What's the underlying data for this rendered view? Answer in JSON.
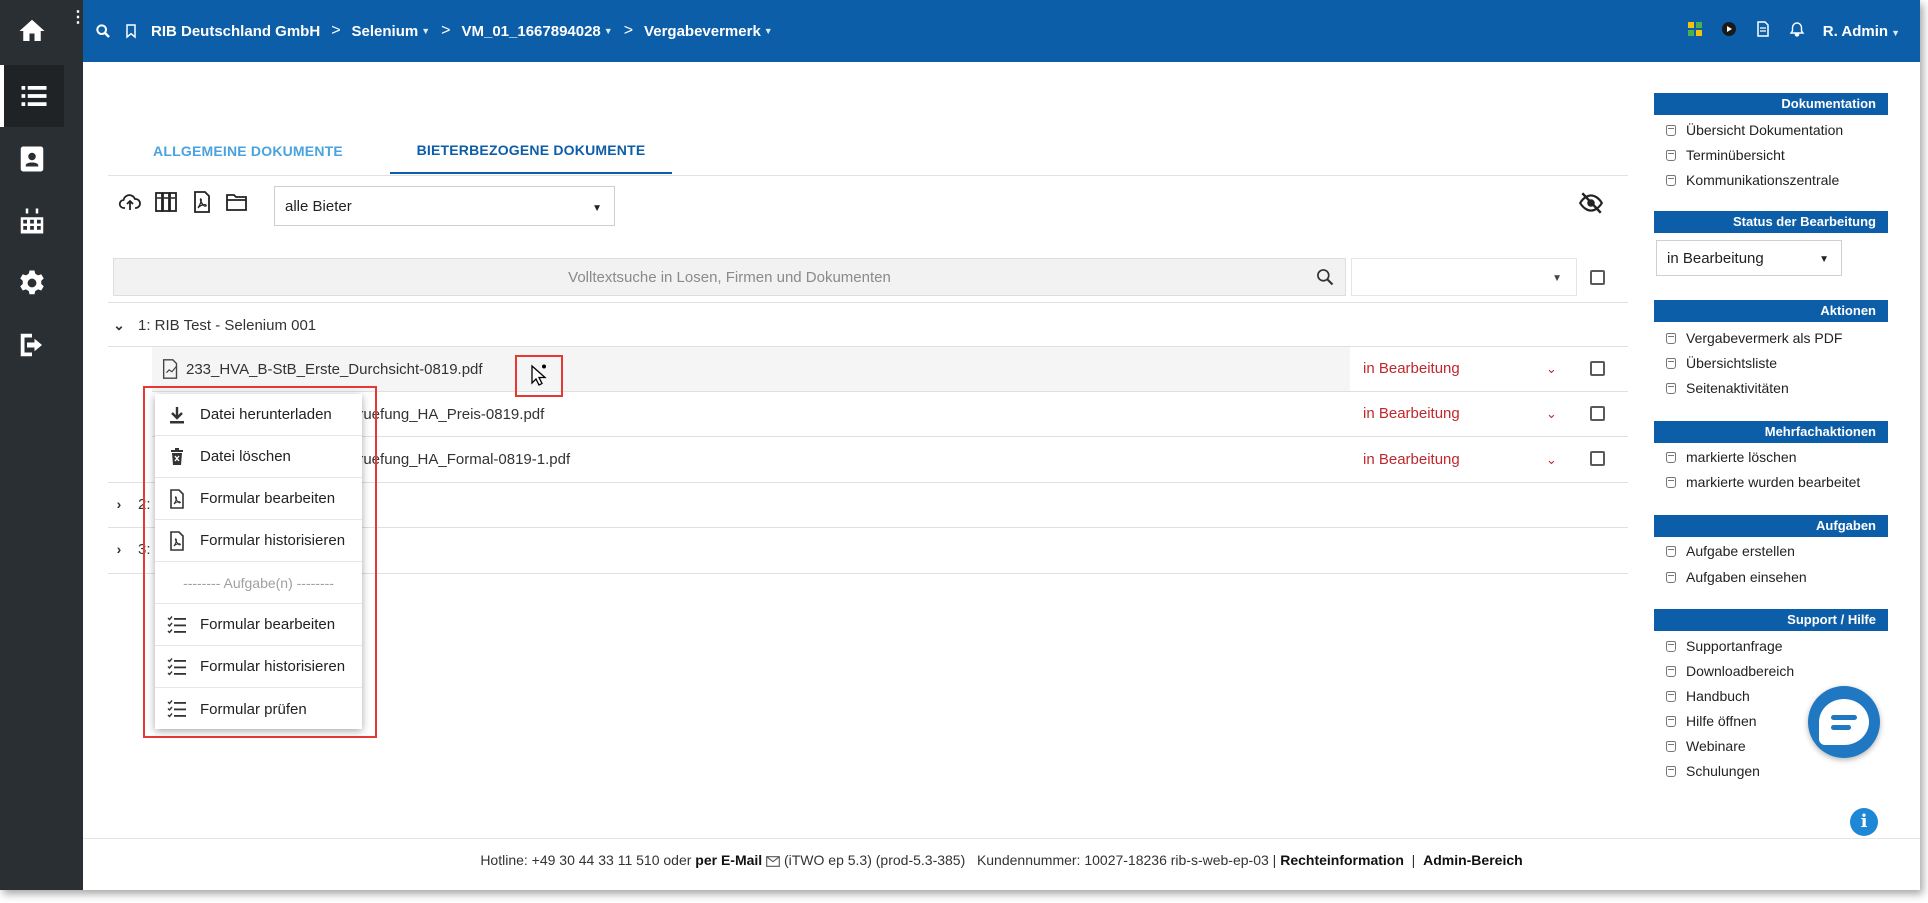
{
  "topbar": {
    "breadcrumb": [
      "RIB Deutschland GmbH",
      "Selenium",
      "VM_01_1667894028",
      "Vergabevermerk"
    ],
    "user": "R. Admin"
  },
  "tabs": {
    "allgemeine": "ALLGEMEINE DOKUMENTE",
    "bieter": "BIETERBEZOGENE DOKUMENTE"
  },
  "toolbar": {
    "bidder_filter": "alle Bieter"
  },
  "search": {
    "placeholder": "Volltextsuche in Losen, Firmen und Dokumenten"
  },
  "groups": [
    {
      "label": "1: RIB Test - Selenium 001"
    },
    {
      "label": "2: "
    },
    {
      "label": "3: "
    }
  ],
  "documents": [
    {
      "name": "233_HVA_B-StB_Erste_Durchsicht-0819.pdf",
      "status": "in Bearbeitung"
    },
    {
      "name": "pruefung_HA_Preis-0819.pdf",
      "status": "in Bearbeitung"
    },
    {
      "name": "pruefung_HA_Formal-0819-1.pdf",
      "status": "in Bearbeitung"
    }
  ],
  "context_menu": {
    "download": "Datei herunterladen",
    "delete": "Datei löschen",
    "edit_form": "Formular bearbeiten",
    "historize_form": "Formular historisieren",
    "task_divider": "-------- Aufgabe(n) --------",
    "task_edit_form": "Formular bearbeiten",
    "task_historize_form": "Formular historisieren",
    "task_check_form": "Formular prüfen"
  },
  "sidebar": {
    "doku_header": "Dokumentation",
    "doku_items": [
      "Übersicht Dokumentation",
      "Terminübersicht",
      "Kommunikationszentrale"
    ],
    "status_header": "Status der Bearbeitung",
    "status_value": "in Bearbeitung",
    "aktionen_header": "Aktionen",
    "aktionen_items": [
      "Vergabevermerk als PDF",
      "Übersichtsliste",
      "Seitenaktivitäten"
    ],
    "mehrfach_header": "Mehrfachaktionen",
    "mehrfach_items": [
      "markierte löschen",
      "markierte wurden bearbeitet"
    ],
    "aufgaben_header": "Aufgaben",
    "aufgaben_items": [
      "Aufgabe erstellen",
      "Aufgaben einsehen"
    ],
    "support_header": "Support / Hilfe",
    "support_items": [
      "Supportanfrage",
      "Downloadbereich",
      "Handbuch",
      "Hilfe öffnen",
      "Webinare",
      "Schulungen"
    ]
  },
  "footer": {
    "hotline": "Hotline: +49 30 44 33 11 510 oder",
    "email": "per E-Mail",
    "version": "(iTWO ep 5.3) (prod-5.3-385)",
    "customer": "Kundennummer: 10027-18236 rib-s-web-ep-03 |",
    "legal": "Rechteinformation",
    "pipe": "|",
    "admin": "Admin-Bereich"
  },
  "colors": {
    "brand_blue": "#0d5ea8",
    "nav_dark": "#2a2f33",
    "status_red": "#c0272d",
    "highlight_red": "#e53935",
    "tab_light_blue": "#4aa3df"
  }
}
